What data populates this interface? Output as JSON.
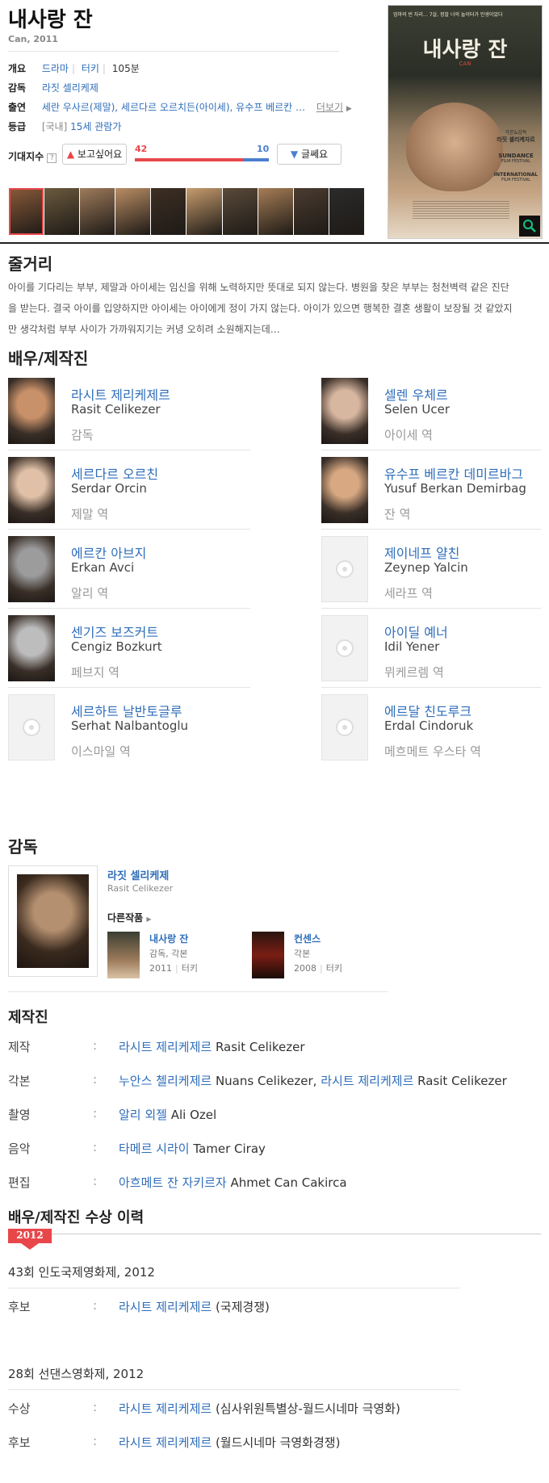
{
  "movie": {
    "title": "내사랑 잔",
    "subtitle": "Can, 2011"
  },
  "info": {
    "overview_label": "개요",
    "genre": "드라마",
    "country": "터키",
    "runtime": "105분",
    "director_label": "감독",
    "director": "라짓 셀리케제",
    "cast_label": "출연",
    "cast_text": "세란 우사르(제말), 세르다르 오르치든(아이세), 유수프 베르칸 …",
    "more": "더보기",
    "rating_label": "등급",
    "rating_prefix": "[국내]",
    "rating": "15세 관람가"
  },
  "expect": {
    "label": "기대지수",
    "help": "?",
    "want_button": "보고싶어요",
    "want_count": "42",
    "meh_count": "10",
    "meh_button": "글쎄요",
    "want_fraction": 0.81
  },
  "poster": {
    "tagline": "엄마의 빈 자리… 7살, 정말 너의 놀이터가 인생이었다",
    "title": "내사랑 잔",
    "title_en": "CAN",
    "credit_line1": "각본&감독",
    "credit_line2": "라짓 셀리케자르",
    "festival1": "SUNDANCE",
    "festival1_sub": "FILM FESTIVAL",
    "festival2": "INTERNATIONAL",
    "festival2_sub": "FILM FESTIVAL"
  },
  "stills_count": 10,
  "synopsis": {
    "title": "줄거리",
    "line1": "아이를 기다리는 부부, 제말과 아이세는 임신을 위해 노력하지만 뜻대로 되지 않는다. 병원을 찾은 부부는 청천벽력 같은 진단",
    "line2": "을 받는다. 결국 아이를 입양하지만 아이세는 아이에게 정이 가지 않는다. 아이가 있으면 행복한 결혼 생활이 보장될 것 같았지",
    "line3": "만 생각처럼 부부 사이가 가까워지기는 커녕 오히려 소원해지는데…"
  },
  "cast": {
    "title": "배우/제작진",
    "people": [
      {
        "name": "라시트 제리케제르",
        "en": "Rasit Celikezer",
        "role": "감독"
      },
      {
        "name": "셀렌 우체르",
        "en": "Selen Ucer",
        "role": "아이세 역"
      },
      {
        "name": "세르다르 오르친",
        "en": "Serdar Orcin",
        "role": "제말 역"
      },
      {
        "name": "유수프 베르칸 데미르바그",
        "en": "Yusuf Berkan Demirbag",
        "role": "잔 역"
      },
      {
        "name": "에르칸 아브지",
        "en": "Erkan Avci",
        "role": "알리 역"
      },
      {
        "name": "제이네프 얄친",
        "en": "Zeynep Yalcin",
        "role": "세라프 역"
      },
      {
        "name": "센기즈 보즈커트",
        "en": "Cengiz Bozkurt",
        "role": "페브지 역"
      },
      {
        "name": "아이딜 예너",
        "en": "Idil Yener",
        "role": "뮈케르렘 역"
      },
      {
        "name": "세르하트 날반토글루",
        "en": "Serhat Nalbantoglu",
        "role": "이스마일 역"
      },
      {
        "name": "에르달 친도루크",
        "en": "Erdal Cindoruk",
        "role": "메흐메트 우스타 역"
      }
    ]
  },
  "director_section": {
    "title": "감독",
    "name": "라짓 셀리케제",
    "en": "Rasit Celikezer",
    "other_works": "다른작품",
    "works": [
      {
        "title": "내사랑 잔",
        "role": "감독, 각본",
        "year": "2011",
        "country": "터키"
      },
      {
        "title": "컨센스",
        "role": "각본",
        "year": "2008",
        "country": "터키"
      }
    ]
  },
  "crew": {
    "title": "제작진",
    "colon": ":",
    "rows": [
      {
        "label": "제작",
        "name1": "라시트 제리케제르",
        "en1": "Rasit Celikezer"
      },
      {
        "label": "각본",
        "name1": "누안스 첼리케제르",
        "en1": "Nuans Celikezer,",
        "name2": "라시트 제리케제르",
        "en2": "Rasit Celikezer"
      },
      {
        "label": "촬영",
        "name1": "알리 외젤",
        "en1": "Ali Ozel"
      },
      {
        "label": "음악",
        "name1": "타메르 시라이",
        "en1": "Tamer Ciray"
      },
      {
        "label": "편집",
        "name1": "아흐메트 잔 자키르자",
        "en1": "Ahmet Can Cakirca"
      }
    ]
  },
  "awards": {
    "title": "배우/제작진 수상 이력",
    "year": "2012",
    "events": [
      {
        "name": "43회 인도국제영화제, 2012",
        "rows": [
          {
            "label": "후보",
            "person": "라시트 제리케제르",
            "detail": "(국제경쟁)"
          }
        ]
      },
      {
        "name": "28회 선댄스영화제, 2012",
        "rows": [
          {
            "label": "수상",
            "person": "라시트 제리케제르",
            "detail": "(심사위원특별상-월드시네마 극영화)"
          },
          {
            "label": "후보",
            "person": "라시트 제리케제르",
            "detail": "(월드시네마 극영화경쟁)"
          }
        ]
      }
    ]
  },
  "colors": {
    "link": "#2f6eba",
    "want_bar": "#e8474a",
    "meh_bar": "#4a7fcf",
    "badge": "#e8474a"
  },
  "icons": {
    "magnifier": "search-icon",
    "thumb_up": "thumb-up-icon",
    "thumb_down": "thumb-down-icon",
    "film_reel": "film-reel-icon"
  }
}
